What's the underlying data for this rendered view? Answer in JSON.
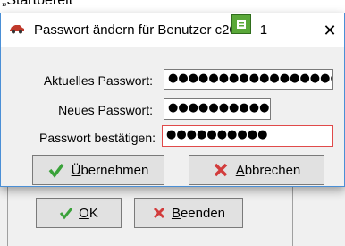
{
  "background": {
    "strip_text": "„Startbereit“",
    "buttons": {
      "ok": "OK",
      "quit": "Beenden"
    }
  },
  "dialog": {
    "title": "Passwort ändern für Benutzer c20",
    "title_suffix": "1",
    "fields": {
      "current": {
        "label": "Aktuelles Passwort:",
        "value": "●●●●●●●●●●●●●●●●●●●●"
      },
      "new": {
        "label": "Neues Passwort:",
        "value": "●●●●●●●●●●"
      },
      "confirm": {
        "label": "Passwort bestätigen:",
        "value": "●●●●●●●●●●"
      }
    },
    "buttons": {
      "apply": "Übernehmen",
      "cancel": "Abbrechen"
    }
  },
  "colors": {
    "accent": "#4a8fd6",
    "error_border": "#e04a4a",
    "check_green": "#3aa23a",
    "cross_red": "#d23c3c"
  }
}
